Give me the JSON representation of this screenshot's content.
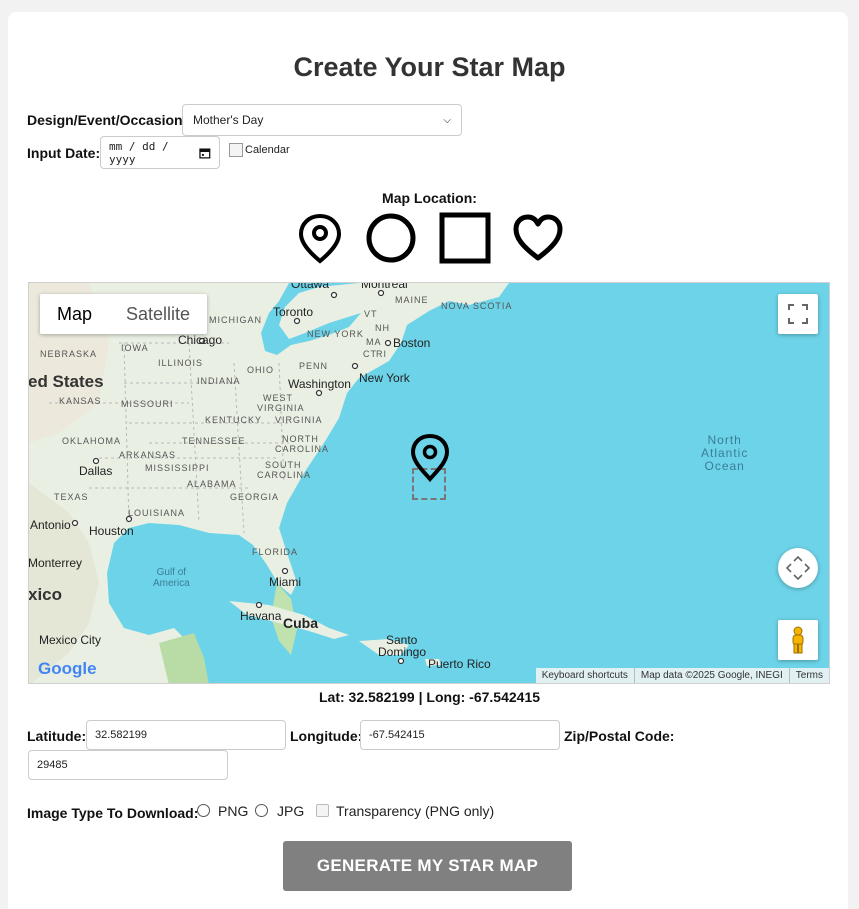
{
  "page": {
    "title": "Create Your Star Map"
  },
  "design": {
    "label": "Design/Event/Occasion:",
    "selected": "Mother's Day"
  },
  "date": {
    "label": "Input Date:",
    "placeholder": "mm / dd / yyyy",
    "calendar_alt": "Calendar"
  },
  "map_location": {
    "label": "Map Location:",
    "shapes": [
      "pin-icon",
      "circle-icon",
      "square-icon",
      "heart-icon"
    ]
  },
  "map": {
    "type_buttons": [
      "Map",
      "Satellite"
    ],
    "active_type": "Map",
    "labels": {
      "ottawa": "Ottawa",
      "montreal": "Montreal",
      "maine": "MAINE",
      "nova_scotia": "NOVA SCOTIA",
      "michigan": "MICHIGAN",
      "toronto": "Toronto",
      "vt": "VT",
      "nh": "NH",
      "new_york_state": "NEW YORK",
      "boston": "Boston",
      "ma": "MA",
      "ct": "CT",
      "ri": "RI",
      "nebraska": "NEBRASKA",
      "iowa": "IOWA",
      "chicago": "Chicago",
      "illinois": "ILLINOIS",
      "ohio": "OHIO",
      "penn": "PENN",
      "indiana": "INDIANA",
      "united_states": "ed States",
      "washington": "Washington",
      "new_york": "New York",
      "kansas": "KANSAS",
      "missouri": "MISSOURI",
      "west_virginia_1": "WEST",
      "west_virginia_2": "VIRGINIA",
      "kentucky": "KENTUCKY",
      "virginia": "VIRGINIA",
      "oklahoma": "OKLAHOMA",
      "tennessee": "TENNESSEE",
      "north_carolina_1": "NORTH",
      "north_carolina_2": "CAROLINA",
      "arkansas": "ARKANSAS",
      "mississippi": "MISSISSIPPI",
      "south_carolina_1": "SOUTH",
      "south_carolina_2": "CAROLINA",
      "dallas": "Dallas",
      "alabama": "ALABAMA",
      "georgia": "GEORGIA",
      "texas": "TEXAS",
      "louisiana": "LOUISIANA",
      "antonio": "Antonio",
      "houston": "Houston",
      "florida": "FLORIDA",
      "monterrey": "Monterrey",
      "gulf_1": "Gulf of",
      "gulf_2": "America",
      "miami": "Miami",
      "xico": "xico",
      "havana": "Havana",
      "cuba": "Cuba",
      "mexico_city": "Mexico City",
      "santo_domingo_1": "Santo",
      "santo_domingo_2": "Domingo",
      "puerto_rico": "Puerto Rico",
      "ocean_1": "North",
      "ocean_2": "Atlantic",
      "ocean_3": "Ocean"
    },
    "attribution": [
      "Keyboard shortcuts",
      "Map data ©2025 Google, INEGI",
      "Terms"
    ],
    "logo": "Google"
  },
  "coords_display": "Lat: 32.582199 | Long: -67.542415",
  "fields": {
    "latitude_label": "Latitude:",
    "latitude_value": "32.582199",
    "longitude_label": "Longitude:",
    "longitude_value": "-67.542415",
    "zip_label": "Zip/Postal Code:",
    "zip_value": "29485"
  },
  "download": {
    "label": "Image Type To Download:",
    "png": "PNG",
    "jpg": "JPG",
    "transparency": "Transparency (PNG only)"
  },
  "generate_button": "GENERATE MY STAR MAP",
  "colors": {
    "water": "#6dd3e8",
    "land": "#e8f0e2",
    "button": "#808080"
  }
}
